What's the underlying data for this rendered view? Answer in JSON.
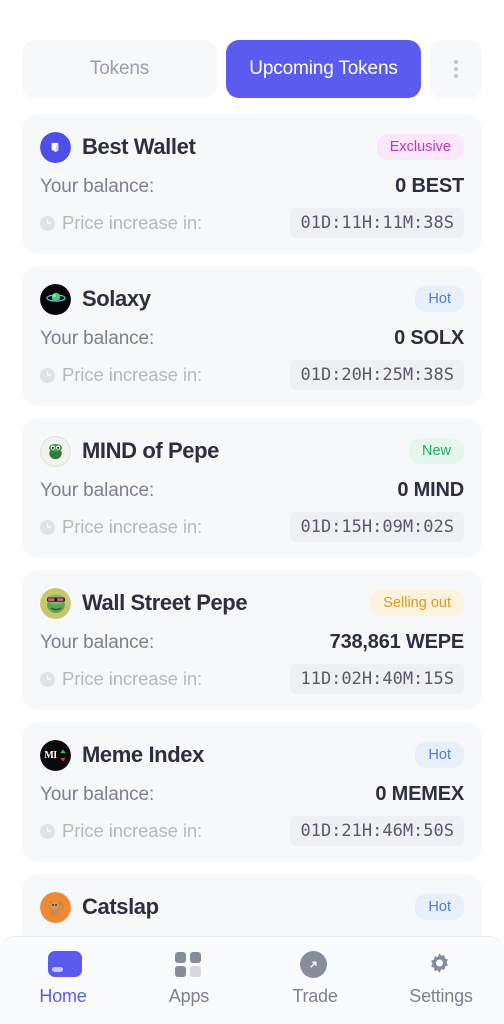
{
  "tabs": {
    "inactive_label": "Tokens",
    "active_label": "Upcoming Tokens",
    "kebab_icon": "more-vertical-icon"
  },
  "labels": {
    "balance": "Your balance:",
    "timer": "Price increase in:"
  },
  "tokens": [
    {
      "name": "Best Wallet",
      "icon": "best-wallet-logo",
      "badge": "Exclusive",
      "badge_type": "exclusive",
      "balance": "0 BEST",
      "countdown": "01D:11H:11M:38S"
    },
    {
      "name": "Solaxy",
      "icon": "solaxy-logo",
      "badge": "Hot",
      "badge_type": "hot",
      "balance": "0 SOLX",
      "countdown": "01D:20H:25M:38S"
    },
    {
      "name": "MIND of Pepe",
      "icon": "mind-of-pepe-logo",
      "badge": "New",
      "badge_type": "new",
      "balance": "0 MIND",
      "countdown": "01D:15H:09M:02S"
    },
    {
      "name": "Wall Street Pepe",
      "icon": "wall-street-pepe-logo",
      "badge": "Selling out",
      "badge_type": "selling",
      "balance": "738,861 WEPE",
      "countdown": "11D:02H:40M:15S"
    },
    {
      "name": "Meme Index",
      "icon": "meme-index-logo",
      "badge": "Hot",
      "badge_type": "hot",
      "balance": "0 MEMEX",
      "countdown": "01D:21H:46M:50S"
    },
    {
      "name": "Catslap",
      "icon": "catslap-logo",
      "badge": "Hot",
      "badge_type": "hot",
      "balance": "",
      "countdown": ""
    }
  ],
  "bottom_nav": [
    {
      "label": "Home",
      "icon": "wallet-icon",
      "active": true
    },
    {
      "label": "Apps",
      "icon": "grid-icon",
      "active": false
    },
    {
      "label": "Trade",
      "icon": "trade-icon",
      "active": false
    },
    {
      "label": "Settings",
      "icon": "gear-icon",
      "active": false
    }
  ],
  "colors": {
    "accent": "#5b5bef",
    "card_bg": "#f7f8fa",
    "badge_exclusive_bg": "#fbe6fb",
    "badge_exclusive_fg": "#b936c9",
    "badge_hot_bg": "#e9eefb",
    "badge_hot_fg": "#4a7fd4",
    "badge_new_bg": "#e5f7ed",
    "badge_new_fg": "#24a96a",
    "badge_selling_bg": "#fdf2dd",
    "badge_selling_fg": "#d79c21"
  }
}
